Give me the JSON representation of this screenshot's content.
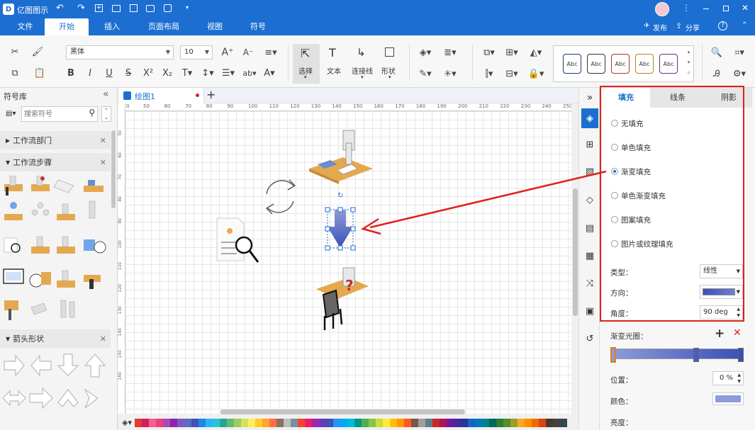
{
  "app": {
    "title": "亿图图示"
  },
  "menu": {
    "tabs": [
      "文件",
      "开始",
      "插入",
      "页面布局",
      "视图",
      "符号"
    ],
    "active": 1,
    "publish": "发布",
    "share": "分享"
  },
  "ribbon": {
    "font_name": "黑体",
    "font_size": "10",
    "tools": {
      "select": "选择",
      "text": "文本",
      "connector": "连接线",
      "shape": "形状"
    },
    "style_label": "Abc"
  },
  "library": {
    "title": "符号库",
    "search_placeholder": "搜索符号",
    "sections": [
      {
        "label": "工作流部门",
        "expanded": false
      },
      {
        "label": "工作流步骤",
        "expanded": true
      },
      {
        "label": "箭头形状",
        "expanded": true
      }
    ]
  },
  "document": {
    "tab": "绘图1"
  },
  "ruler": {
    "h_ticks": [
      "0",
      "50",
      "60",
      "70",
      "80",
      "90",
      "100",
      "110",
      "120",
      "130",
      "140",
      "150",
      "160",
      "170",
      "180",
      "190",
      "200",
      "210",
      "220",
      "230",
      "240",
      "250"
    ],
    "v_ticks": [
      "50",
      "60",
      "70",
      "80",
      "90",
      "100",
      "110",
      "120",
      "130",
      "140",
      "150",
      "160"
    ]
  },
  "panel": {
    "tabs": [
      "填充",
      "线条",
      "阴影"
    ],
    "active_tab": 0,
    "fill_options": [
      "无填充",
      "单色填充",
      "渐变填充",
      "单色渐变填充",
      "图案填充",
      "图片或纹理填充"
    ],
    "selected_fill": 2,
    "type_label": "类型：",
    "type_value": "线性",
    "direction_label": "方向：",
    "angle_label": "角度：",
    "angle_value": "90 deg",
    "gradient_stops_label": "渐变光圈：",
    "position_label": "位置：",
    "position_value": "0 %",
    "color_label": "颜色：",
    "brightness_label": "亮度："
  },
  "colors": {
    "accent": "#1c6fd1",
    "highlight": "#e0201c",
    "gradient_start": "#3a4fb8",
    "gradient_end": "#8f9bd8"
  },
  "palette": [
    "#e53935",
    "#d81b60",
    "#f06292",
    "#ec407a",
    "#ab47bc",
    "#8e24aa",
    "#7e57c2",
    "#5c6bc0",
    "#3f51b5",
    "#1e88e5",
    "#29b6f6",
    "#26c6da",
    "#26a69a",
    "#66bb6a",
    "#9ccc65",
    "#d4e157",
    "#ffee58",
    "#ffca28",
    "#ffa726",
    "#ff7043",
    "#8d6e63",
    "#bdbdbd",
    "#78909c",
    "#f44336",
    "#e91e63",
    "#9c27b0",
    "#673ab7",
    "#3f51b5",
    "#2196f3",
    "#03a9f4",
    "#00bcd4",
    "#009688",
    "#4caf50",
    "#8bc34a",
    "#cddc39",
    "#ffeb3b",
    "#ffc107",
    "#ff9800",
    "#ff5722",
    "#795548",
    "#9e9e9e",
    "#607d8b",
    "#c62828",
    "#ad1457",
    "#6a1b9a",
    "#4527a0",
    "#283593",
    "#1565c0",
    "#0277bd",
    "#00838f",
    "#00695c",
    "#2e7d32",
    "#558b2f",
    "#9e9d24",
    "#f9a825",
    "#ff8f00",
    "#ef6c00",
    "#d84315",
    "#4e342e",
    "#424242",
    "#37474f"
  ]
}
